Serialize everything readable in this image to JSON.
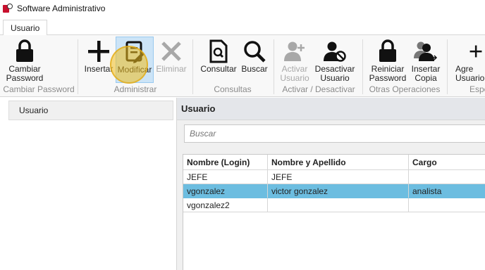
{
  "window": {
    "title": "Software Administrativo"
  },
  "tabs": [
    {
      "label": "Usuario",
      "selected": true
    }
  ],
  "ribbon": {
    "buttons": [
      {
        "label": "Cambiar\nPassword",
        "icon": "lock-icon",
        "enabled": true
      },
      {
        "label": "Insertar",
        "icon": "plus-icon",
        "enabled": true
      },
      {
        "label": "Modificar",
        "icon": "edit-document-icon",
        "enabled": false,
        "selected": true
      },
      {
        "label": "Eliminar",
        "icon": "x-icon",
        "enabled": false
      },
      {
        "label": "Consultar",
        "icon": "document-search-icon",
        "enabled": true
      },
      {
        "label": "Buscar",
        "icon": "magnifier-icon",
        "enabled": true
      },
      {
        "label": "Activar\nUsuario",
        "icon": "user-add-icon",
        "enabled": false
      },
      {
        "label": "Desactivar\nUsuario",
        "icon": "user-block-icon",
        "enabled": true
      },
      {
        "label": "Reiniciar\nPassword",
        "icon": "lock-icon",
        "enabled": true
      },
      {
        "label": "Insertar\nCopia",
        "icon": "users-copy-icon",
        "enabled": true
      },
      {
        "label": "Agre\nUsuario",
        "icon": "plus-icon",
        "enabled": true
      }
    ],
    "groups": [
      "Cambiar Password",
      "Administrar",
      "Consultas",
      "Activar / Desactivar",
      "Otras Operaciones",
      "Espe"
    ]
  },
  "sidebar": {
    "items": [
      {
        "label": "Usuario"
      }
    ]
  },
  "main": {
    "title": "Usuario",
    "search_placeholder": "Buscar",
    "columns": [
      "Nombre (Login)",
      "Nombre y Apellido",
      "Cargo"
    ],
    "rows": [
      {
        "cells": [
          "JEFE",
          "JEFE",
          ""
        ],
        "selected": false
      },
      {
        "cells": [
          "vgonzalez",
          "victor gonzalez",
          "analista"
        ],
        "selected": true
      },
      {
        "cells": [
          "vgonzalez2",
          "",
          ""
        ],
        "selected": false
      }
    ]
  },
  "colors": {
    "selected_row": "#6cbde0",
    "selected_button": "#cce4f7",
    "disabled_text": "#a8a8a8",
    "click_highlight": "#f0be1e"
  }
}
